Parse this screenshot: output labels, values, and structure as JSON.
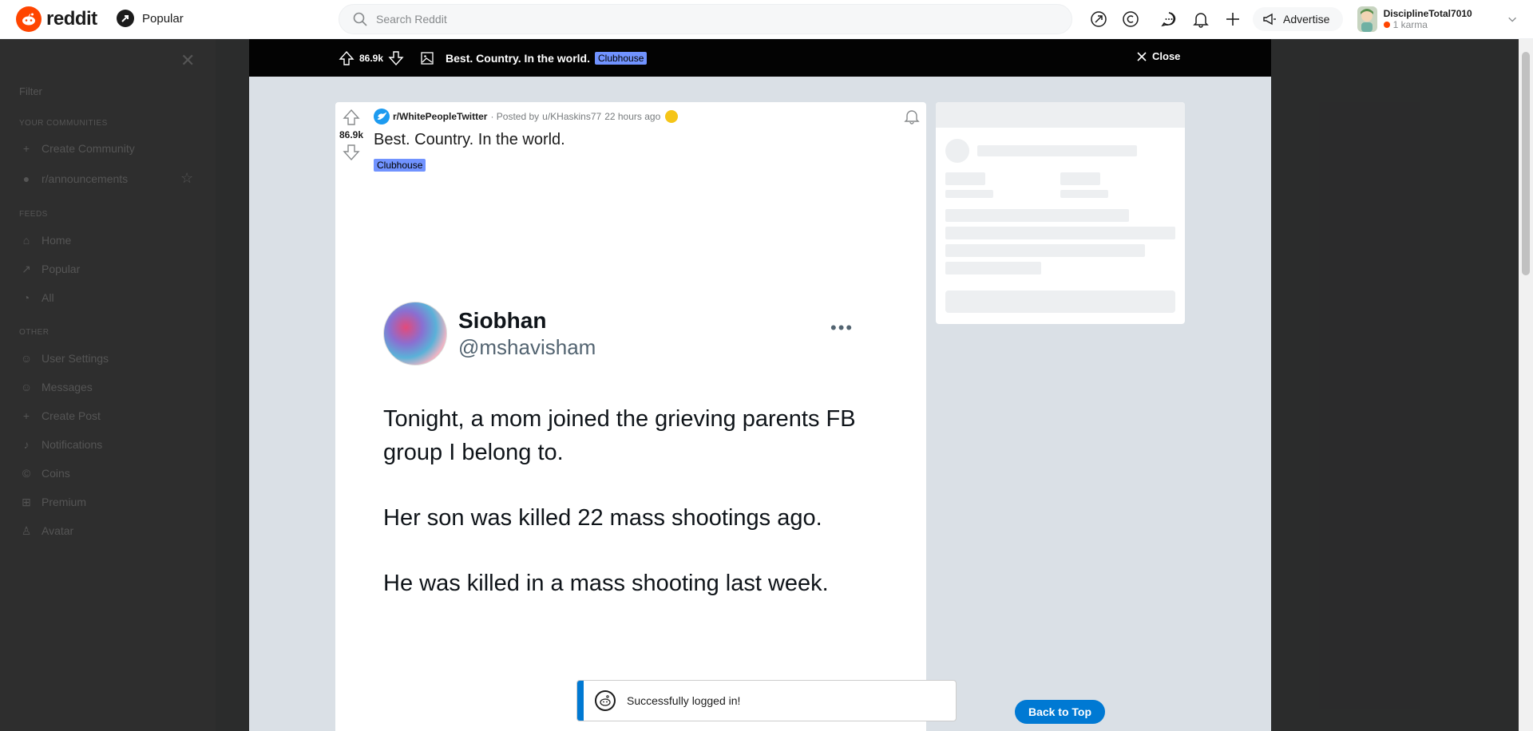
{
  "header": {
    "logo_text": "reddit",
    "feed_label": "Popular",
    "search_placeholder": "Search Reddit",
    "advertise_label": "Advertise",
    "username": "DisciplineTotal7010",
    "karma": "1 karma"
  },
  "sidebar": {
    "filter_placeholder": "Filter",
    "sections": {
      "communities": "YOUR COMMUNITIES",
      "feeds": "FEEDS",
      "other": "OTHER"
    },
    "communities": [
      "Create Community",
      "r/announcements"
    ],
    "feeds": [
      "Home",
      "Popular",
      "All"
    ],
    "other": [
      "User Settings",
      "Messages",
      "Create Post",
      "Notifications",
      "Coins",
      "Premium",
      "Avatar"
    ]
  },
  "modal_bar": {
    "votes": "86.9k",
    "title": "Best. Country. In the world.",
    "flair": "Clubhouse",
    "close_label": "Close"
  },
  "post": {
    "votes": "86.9k",
    "subreddit": "r/WhitePeopleTwitter",
    "posted_by_prefix": "· Posted by",
    "author": "u/KHaskins77",
    "time": "22 hours ago",
    "title": "Best. Country. In the world.",
    "flair": "Clubhouse",
    "tweet": {
      "name": "Siobhan",
      "handle": "@mshavisham",
      "paragraphs": [
        "Tonight, a mom joined the grieving parents FB group I belong to.",
        "Her son was killed 22 mass shootings ago.",
        "He was killed in a mass shooting last week."
      ]
    }
  },
  "toast": {
    "message": "Successfully logged in!"
  },
  "back_to_top": "Back to Top",
  "colors": {
    "brand": "#ff4500",
    "accent": "#0079d3",
    "flair": "#7193ff"
  }
}
